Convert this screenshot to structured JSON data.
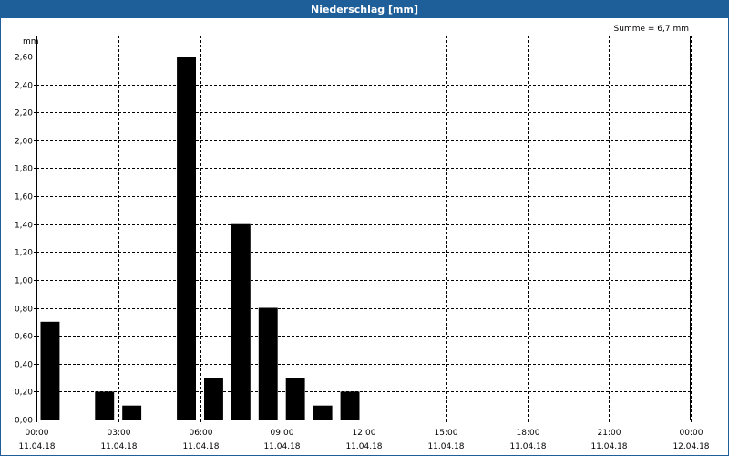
{
  "colors": {
    "title_bg": "#1f5f99",
    "title_fg": "#ffffff",
    "bar": "#000000"
  },
  "chart_data": {
    "type": "bar",
    "title": "Niederschlag [mm]",
    "ylabel": "mm",
    "summary": "Summe = 6,7 mm",
    "ylim": [
      0,
      2.75
    ],
    "xlim_hours": [
      0,
      24
    ],
    "grid": true,
    "y_ticks": [
      "0,00",
      "0,20",
      "0,40",
      "0,60",
      "0,80",
      "1,00",
      "1,20",
      "1,40",
      "1,60",
      "1,80",
      "2,00",
      "2,20",
      "2,40",
      "2,60"
    ],
    "x_ticks": [
      {
        "time": "00:00",
        "date": "11.04.18"
      },
      {
        "time": "03:00",
        "date": "11.04.18"
      },
      {
        "time": "06:00",
        "date": "11.04.18"
      },
      {
        "time": "09:00",
        "date": "11.04.18"
      },
      {
        "time": "12:00",
        "date": "11.04.18"
      },
      {
        "time": "15:00",
        "date": "11.04.18"
      },
      {
        "time": "18:00",
        "date": "11.04.18"
      },
      {
        "time": "21:00",
        "date": "11.04.18"
      },
      {
        "time": "00:00",
        "date": "12.04.18"
      }
    ],
    "series": [
      {
        "x": [
          "01:00",
          "02:00",
          "03:00",
          "04:00",
          "05:00",
          "06:00",
          "07:00",
          "08:00",
          "09:00",
          "10:00",
          "11:00",
          "12:00",
          "13:00"
        ],
        "values": [
          0.7,
          0,
          0.2,
          0.1,
          0,
          2.6,
          0.3,
          1.4,
          0.8,
          0.3,
          0.1,
          0.2,
          0
        ]
      }
    ]
  }
}
